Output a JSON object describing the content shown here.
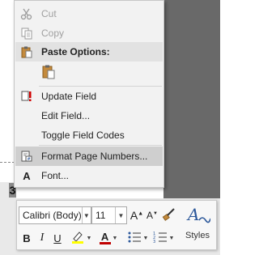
{
  "menu": {
    "cut": "Cut",
    "copy": "Copy",
    "paste_options": "Paste Options:",
    "update_field": "Update Field",
    "edit_field": "Edit Field...",
    "toggle_field_codes": "Toggle Field Codes",
    "format_page_numbers": "Format Page Numbers...",
    "font": "Font..."
  },
  "document": {
    "field_char": "3"
  },
  "toolbar": {
    "font_name": "Calibri (Body)",
    "font_size": "11",
    "bold": "B",
    "italic": "I",
    "underline": "U",
    "styles_label": "Styles"
  },
  "colors": {
    "highlight": "#ffff00",
    "font_color": "#c00000",
    "accent_blue": "#2b579a",
    "styles_blue": "#2b579a"
  }
}
